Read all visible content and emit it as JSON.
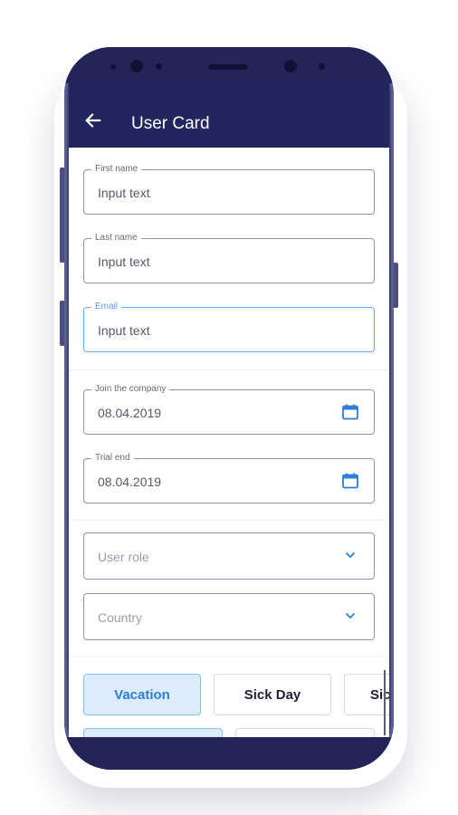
{
  "colors": {
    "appbar": "#23265e",
    "accent": "#2d7fd6",
    "chip_selected_bg": "#dcecfc"
  },
  "header": {
    "title": "User Card",
    "back_icon": "arrow-left-icon"
  },
  "form": {
    "first_name": {
      "label": "First name",
      "value": "Input text"
    },
    "last_name": {
      "label": "Last name",
      "value": "Input text"
    },
    "email": {
      "label": "Email",
      "value": "Input text"
    },
    "join_date": {
      "label": "Join the company",
      "value": "08.04.2019"
    },
    "trial_end": {
      "label": "Trial end",
      "value": "08.04.2019"
    },
    "user_role": {
      "placeholder": "User role"
    },
    "country": {
      "placeholder": "Country"
    }
  },
  "chips": [
    {
      "label": "Vacation",
      "selected": true
    },
    {
      "label": "Sick Day",
      "selected": false
    },
    {
      "label": "Sic",
      "selected": false
    }
  ]
}
